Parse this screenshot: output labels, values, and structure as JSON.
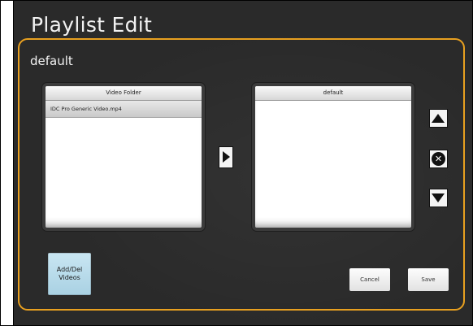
{
  "title": "Playlist Edit",
  "playlist_name": "default",
  "source_list": {
    "header": "Video Folder",
    "items": [
      "IDC Pro Generic Video.mp4"
    ]
  },
  "target_list": {
    "header": "default",
    "items": []
  },
  "controls": {
    "add_icon": "triangle-right-icon",
    "move_up_icon": "triangle-up-icon",
    "remove_icon": "x-circle-icon",
    "move_down_icon": "triangle-down-icon"
  },
  "buttons": {
    "add_del_line1": "Add/Del",
    "add_del_line2": "Videos",
    "cancel": "Cancel",
    "save": "Save"
  },
  "colors": {
    "accent": "#e8a020",
    "background": "#2a2a2a",
    "add_del_button": "#bcdeed"
  }
}
